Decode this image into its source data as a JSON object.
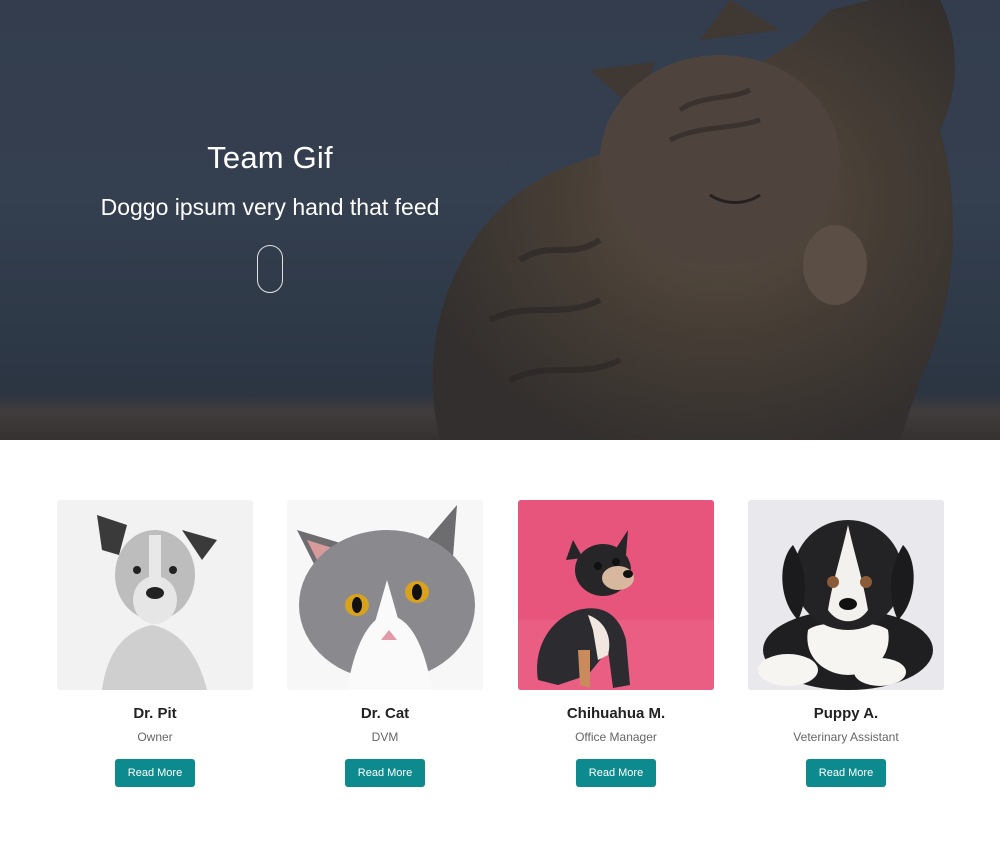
{
  "hero": {
    "title": "Team Gif",
    "subtitle": "Doggo ipsum very hand that feed",
    "scroll_icon": "mouse-scroll-icon",
    "image": "tabby-cat-grooming-photo"
  },
  "team": {
    "members": [
      {
        "name": "Dr. Pit",
        "role": "Owner",
        "button_label": "Read More",
        "photo": "black-and-white-pitbull-photo"
      },
      {
        "name": "Dr. Cat",
        "role": "DVM",
        "button_label": "Read More",
        "photo": "gray-white-cat-photo"
      },
      {
        "name": "Chihuahua M.",
        "role": "Office Manager",
        "button_label": "Read More",
        "photo": "chihuahua-pink-background-photo"
      },
      {
        "name": "Puppy A.",
        "role": "Veterinary Assistant",
        "button_label": "Read More",
        "photo": "tricolor-puppy-photo"
      }
    ]
  },
  "colors": {
    "accent": "#0d8a8d",
    "hero_bg": "#3a4556",
    "chihuahua_bg": "#e8557c"
  }
}
